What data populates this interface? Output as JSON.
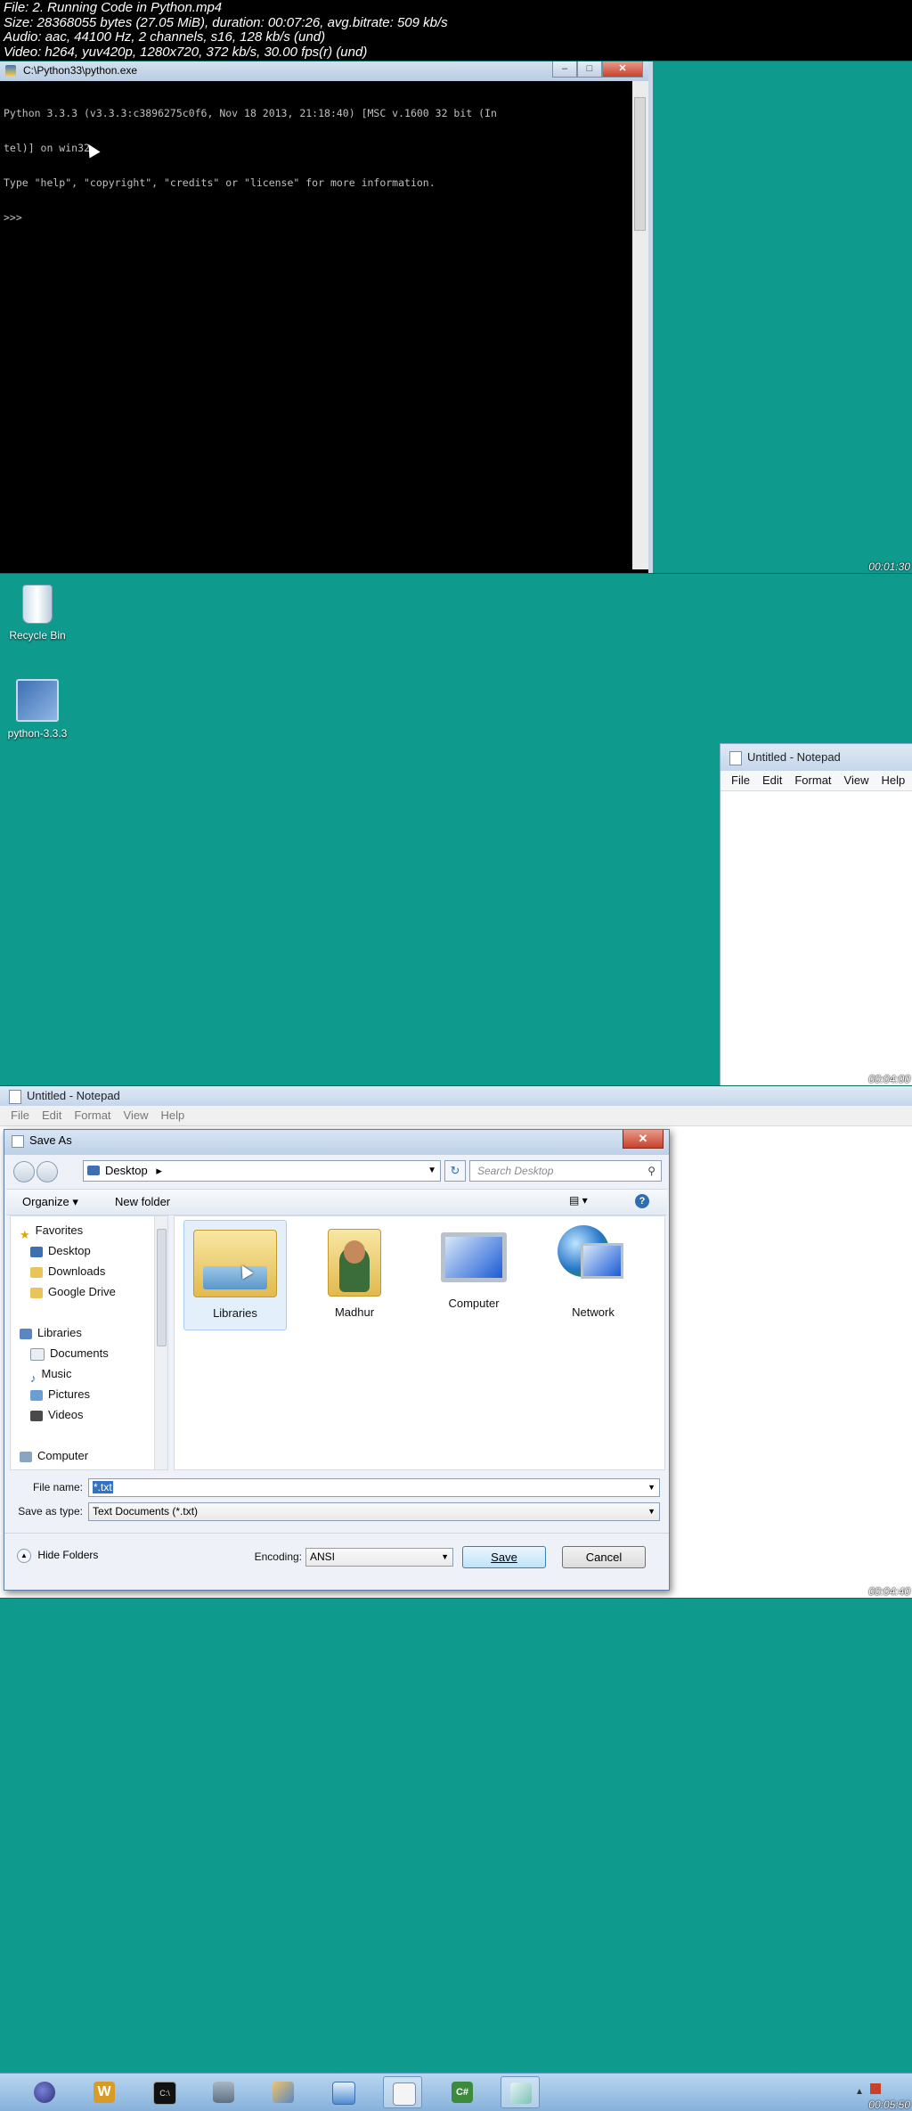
{
  "header": {
    "line1": "File: 2. Running Code in Python.mp4",
    "line2": "Size: 28368055 bytes (27.05 MiB), duration: 00:07:26, avg.bitrate: 509 kb/s",
    "line3": "Audio: aac, 44100 Hz, 2 channels, s16, 128 kb/s (und)",
    "line4": "Video: h264, yuv420p, 1280x720, 372 kb/s, 30.00 fps(r) (und)"
  },
  "frame1": {
    "window_title": "C:\\Python33\\python.exe",
    "console_lines": [
      "Python 3.3.3 (v3.3.3:c3896275c0f6, Nov 18 2013, 21:18:40) [MSC v.1600 32 bit (In",
      "tel)] on win32",
      "Type \"help\", \"copyright\", \"credits\" or \"license\" for more information.",
      ">>>"
    ],
    "timestamp": "00:01:30"
  },
  "frame2": {
    "desktop_icons": [
      "Recycle Bin",
      "python-3.3.3"
    ],
    "notepad_title": "Untitled - Notepad",
    "notepad_menu": [
      "File",
      "Edit",
      "Format",
      "View",
      "Help"
    ],
    "timestamp": "00:04:00"
  },
  "frame3": {
    "notepad_title": "Untitled - Notepad",
    "notepad_menu": [
      "File",
      "Edit",
      "Format",
      "View",
      "Help"
    ],
    "dialog": {
      "title": "Save As",
      "address": "Desktop",
      "search_placeholder": "Search Desktop",
      "organize": "Organize",
      "new_folder": "New folder",
      "nav_items": [
        {
          "label": "Favorites",
          "type": "group"
        },
        {
          "label": "Desktop",
          "type": "item"
        },
        {
          "label": "Downloads",
          "type": "item"
        },
        {
          "label": "Google Drive",
          "type": "item"
        },
        {
          "label": "Libraries",
          "type": "group"
        },
        {
          "label": "Documents",
          "type": "item"
        },
        {
          "label": "Music",
          "type": "item"
        },
        {
          "label": "Pictures",
          "type": "item"
        },
        {
          "label": "Videos",
          "type": "item"
        },
        {
          "label": "Computer",
          "type": "group"
        }
      ],
      "tiles": [
        "Libraries",
        "Madhur",
        "Computer",
        "Network"
      ],
      "file_name_label": "File name:",
      "file_name_value": "*.txt",
      "save_type_label": "Save as type:",
      "save_type_value": "Text Documents (*.txt)",
      "hide_folders": "Hide Folders",
      "encoding_label": "Encoding:",
      "encoding_value": "ANSI",
      "save_button": "Save",
      "cancel_button": "Cancel"
    },
    "timestamp": "00:04:40"
  },
  "frame4": {
    "taskbar_apps": [
      "eclipse-icon",
      "word-icon",
      "cmd-icon",
      "database-icon",
      "network-tool-icon",
      "remote-desktop-icon",
      "notepad-taskbar-icon",
      "csharp-icon",
      "app-icon"
    ],
    "timestamp": "00:05:50"
  }
}
